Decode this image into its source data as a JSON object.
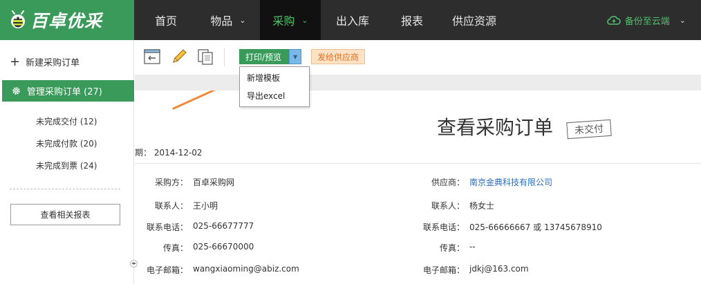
{
  "brand": {
    "name": "百卓优采"
  },
  "nav": {
    "items": [
      {
        "label": "首页",
        "caret": ""
      },
      {
        "label": "物品",
        "caret": "⌄"
      },
      {
        "label": "采购",
        "caret": "⌄"
      },
      {
        "label": "出入库",
        "caret": ""
      },
      {
        "label": "报表",
        "caret": ""
      },
      {
        "label": "供应资源",
        "caret": ""
      }
    ],
    "backup": "备份至云端",
    "backup_caret": "⌄"
  },
  "sidebar": {
    "new_order": "新建采购订单",
    "manage_orders": "管理采购订单 (27)",
    "sub_items": [
      {
        "label": "未完成交付 (12)"
      },
      {
        "label": "未完成付款 (20)"
      },
      {
        "label": "未完成到票 (24)"
      }
    ],
    "report_button": "查看相关报表"
  },
  "toolbar": {
    "print_label": "打印/预览",
    "send_label": "发给供应商",
    "dropdown": [
      {
        "label": "新增模板"
      },
      {
        "label": "导出excel"
      }
    ]
  },
  "order": {
    "title": "查看采购订单",
    "status_stamp": "未交付",
    "date_line": "期：  2014-12-02",
    "buyer": {
      "buyer_label": "采购方：",
      "buyer_value": "百卓采购网",
      "contact_label": "联系人：",
      "contact_value": "王小明",
      "phone_label": "联系电话：",
      "phone_value": "025-66677777",
      "fax_label": "传真：",
      "fax_value": "025-66670000",
      "email_label": "电子邮箱：",
      "email_value": "wangxiaoming@abiz.com"
    },
    "supplier": {
      "supplier_label": "供应商：",
      "supplier_value": "南京金典科技有限公司",
      "contact_label": "联系人：",
      "contact_value": "杨女士",
      "phone_label": "联系电话：",
      "phone_value": "025-66666667 或 13745678910",
      "fax_label": "传真：",
      "fax_value": "--",
      "email_label": "电子邮箱：",
      "email_value": "jdkj@163.com"
    }
  },
  "colors": {
    "brand_green": "#3a9a5a",
    "nav_bg": "#2d2d2d",
    "active_text": "#4fc06c",
    "arrow": "#f08a3a"
  }
}
